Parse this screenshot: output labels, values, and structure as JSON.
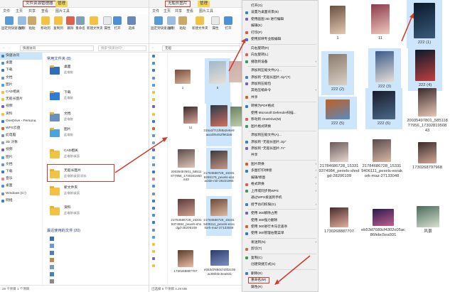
{
  "colors": {
    "accent": "#d23b2e",
    "selection": "#cde6fb",
    "folder": "#f2c244",
    "title_tab_yellow": "#f6d65a"
  },
  "win1": {
    "title": "文件资源管理器",
    "context_tab": "管理",
    "ribbon_tabs": [
      "文件",
      "主页",
      "共享",
      "查看",
      "图片工具"
    ],
    "ribbon_buttons": [
      "固定到快速访问",
      "复制",
      "粘贴",
      "移动到",
      "复制到",
      "删除",
      "重命名",
      "新建文件夹",
      "属性",
      "打开",
      "选择"
    ],
    "address": "快速访问",
    "search_placeholder": "搜索\"快速访问\"",
    "nav_items": [
      "快速访问",
      "桌面",
      "下载",
      "文档",
      "图片",
      "CAD相关",
      "无船长图片",
      "视频",
      "资料",
      "OneDrive - Persona",
      "WPS云盘",
      "此电脑",
      "3D 对象",
      "视频",
      "图片",
      "文档",
      "下载",
      "音乐",
      "桌面",
      "Windows (C:)",
      "网络"
    ],
    "frequent_header": "常用文件夹 (8)",
    "folders": [
      {
        "name": "桌面",
        "sub": "此电脑"
      },
      {
        "name": "下载",
        "sub": "此电脑"
      },
      {
        "name": "文档",
        "sub": "此电脑"
      },
      {
        "name": "图片",
        "sub": "此电脑"
      },
      {
        "name": "CAD相关",
        "sub": "此电脑\\桌面"
      },
      {
        "name": "无船长图片",
        "sub": "此电脑\\桌面\\资料"
      },
      {
        "name": "新文件夹",
        "sub": "此电脑\\桌面"
      },
      {
        "name": "资料",
        "sub": "此电脑\\桌面"
      }
    ],
    "recent_header": "最近使用的文件 (20)",
    "status": "28 个项目   1 个项目"
  },
  "win2": {
    "title": "无船长图片",
    "context_tab": "管理",
    "ribbon_tabs": [
      "文件",
      "主页",
      "共享",
      "查看",
      "图片工具"
    ],
    "ribbon_buttons": [
      "固定到快速访问",
      "复制",
      "粘贴",
      "新建文件夹",
      "属性",
      "打开"
    ],
    "address": "无船",
    "captions": [
      "1",
      "5",
      "",
      "11",
      "315a1f7c1f68a2e6e9aacd05452f963a5",
      "",
      "20035497801_58511877956_1730281950843",
      "21784686728_153319299179_pexels-alotaolde-mir-28221965",
      "21784686728_153319374984_pexels-shndgd-28206109",
      "21784686728_153319406111_pexels-esrakork-maz-27133048",
      "1730268887707",
      "eb53d7680cf4302c05ac86febc5ea931"
    ],
    "status": "已选择 6 个项目  4.29 MB"
  },
  "context_menu": {
    "items": [
      {
        "label": "打开(O)",
        "arrow": false
      },
      {
        "label": "设置为桌面背景(B)",
        "arrow": false
      },
      {
        "label": "使用画图 3D 进行编辑",
        "arrow": false
      },
      {
        "label": "编辑(E)",
        "arrow": false
      },
      {
        "label": "打印(P)",
        "arrow": false
      },
      {
        "label": "使用剪映专业版编辑",
        "arrow": false
      },
      {
        "label": "向右旋转(R)",
        "arrow": false
      },
      {
        "label": "向左旋转(L)",
        "arrow": false
      },
      {
        "label": "播放到设备",
        "arrow": true
      },
      {
        "label": "添加到压缩文件(A)...",
        "arrow": false
      },
      {
        "label": "添加到 \"无船长图片.zip\"(T)",
        "arrow": false
      },
      {
        "label": "添加到压缩包",
        "arrow": false
      },
      {
        "label": "其他压缩命令",
        "arrow": true
      },
      {
        "label": "共享",
        "arrow": false
      },
      {
        "label": "转换为PDF格式",
        "arrow": false
      },
      {
        "label": "使用 Microsoft Defender扫描...",
        "arrow": false
      },
      {
        "label": "移动到 OneDrive(M)",
        "arrow": false
      },
      {
        "label": "图片格式转换",
        "arrow": false
      },
      {
        "label": "添加到压缩文件(A)...",
        "arrow": false
      },
      {
        "label": "添加到 \"无船长图片.zip\"",
        "arrow": false
      },
      {
        "label": "添加到 \"无船长图片.7z\"",
        "arrow": false
      },
      {
        "label": "共享",
        "arrow": false
      },
      {
        "label": "图片转换",
        "arrow": true
      },
      {
        "label": "多图打印/拼接",
        "arrow": true
      },
      {
        "label": "编辑/修图",
        "arrow": true
      },
      {
        "label": "格式转换",
        "arrow": true
      },
      {
        "label": "上传或同步到WPS",
        "arrow": true
      },
      {
        "label": "通过WPS发送到手机",
        "arrow": false
      },
      {
        "label": "授予访问权限(G)",
        "arrow": true
      },
      {
        "label": "使用 360解除占用",
        "arrow": false
      },
      {
        "label": "使用 360强力删除",
        "arrow": false
      },
      {
        "label": "使用 360进行木马云查杀",
        "arrow": false
      },
      {
        "label": "使用 360管理右键菜单",
        "arrow": false
      },
      {
        "label": "发送到(N)",
        "arrow": true
      },
      {
        "label": "剪切(T)",
        "arrow": false
      },
      {
        "label": "复制(C)",
        "arrow": false
      },
      {
        "label": "创建快捷方式(S)",
        "arrow": false
      },
      {
        "label": "删除(D)",
        "arrow": false
      },
      {
        "label": "重命名(M)",
        "arrow": false
      },
      {
        "label": "属性(R)",
        "arrow": false
      }
    ]
  },
  "right_panel": {
    "captions": [
      "1",
      "11",
      "222 (1)",
      "222 (2)",
      "222 (3)",
      "222 (4)",
      "222 (5)",
      "222 (6)",
      "20035497801_58511877956_1730281950843",
      "21784686728_153319374984_pexels-shndgd-28206109",
      "21784686728_153319406111_pexels-esrakork-maz-27133048",
      "1730268797968",
      "1730268887707",
      "eb53d7680cf4302c05ac86febc5ea931",
      "风景"
    ]
  }
}
